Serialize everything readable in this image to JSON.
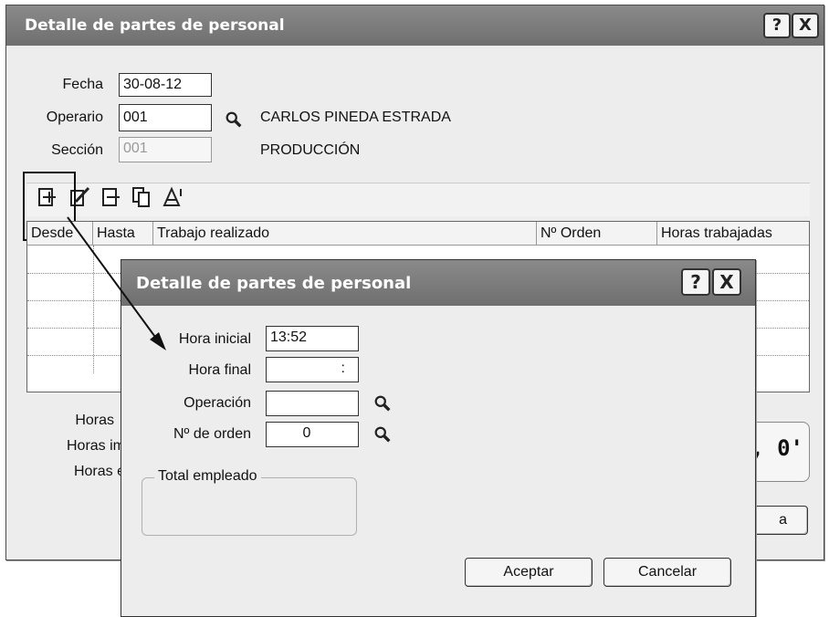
{
  "main": {
    "title": "Detalle de partes de personal",
    "help_label": "?",
    "close_label": "X",
    "fecha_label": "Fecha",
    "fecha_value": "30-08-12",
    "operario_label": "Operario",
    "operario_value": "001",
    "operario_name": "CARLOS PINEDA ESTRADA",
    "seccion_label": "Sección",
    "seccion_value": "001",
    "seccion_name": "PRODUCCIÓN",
    "grid": {
      "headers": [
        "Desde",
        "Hasta",
        "Trabajo realizado",
        "Nº Orden",
        "Horas trabajadas"
      ]
    },
    "totals": {
      "horas_label": "Horas",
      "horas_im_label": "Horas im",
      "horas_e_label": "Horas e",
      "total_value": "h, 0'",
      "bottom_button_label": "a"
    }
  },
  "dialog": {
    "title": "Detalle de partes de personal",
    "help_label": "?",
    "close_label": "X",
    "hora_inicial_label": "Hora inicial",
    "hora_inicial_value": "13:52",
    "hora_final_label": "Hora final",
    "hora_final_value": ":",
    "operacion_label": "Operación",
    "operacion_value": "",
    "orden_label": "Nº de orden",
    "orden_value": "0",
    "total_group_label": "Total empleado",
    "accept_label": "Aceptar",
    "cancel_label": "Cancelar"
  }
}
